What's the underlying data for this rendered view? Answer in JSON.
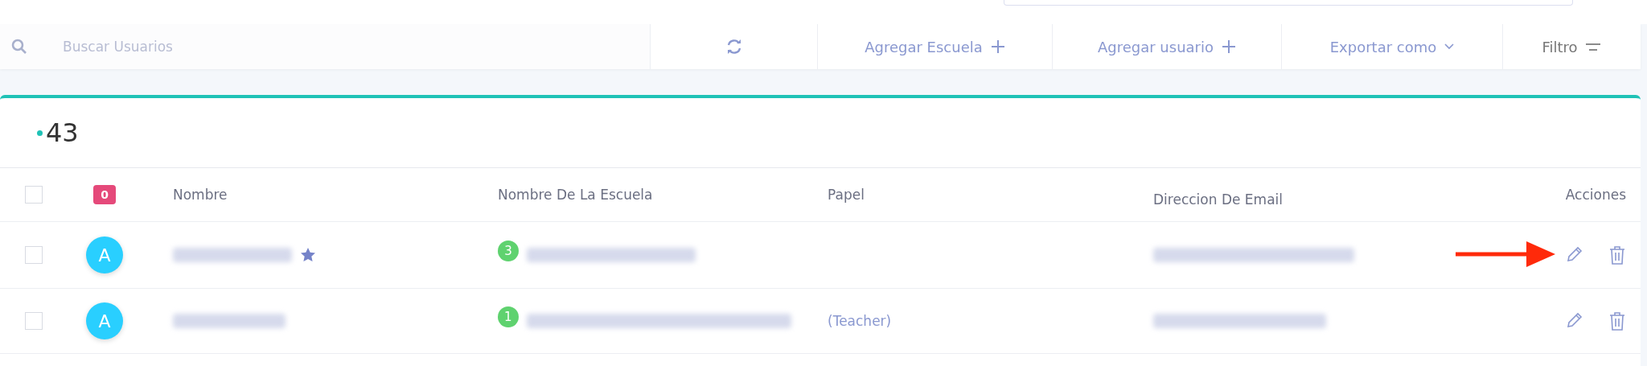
{
  "toolbar": {
    "search": {
      "placeholder": "Buscar Usuarios"
    },
    "actions": [
      {
        "kind": "refresh"
      },
      {
        "kind": "add",
        "label": "Agregar Escuela"
      },
      {
        "kind": "add",
        "label": "Agregar usuario"
      },
      {
        "kind": "dropdown",
        "label": "Exportar como"
      },
      {
        "kind": "filter",
        "label": "Filtro"
      }
    ]
  },
  "card": {
    "count": "43",
    "table": {
      "all_checked": false,
      "selected_badge": "0",
      "columns": [
        "Nombre",
        "Nombre De La Escuela",
        "Papel",
        "Direccion De Email",
        "Acciones"
      ],
      "rows": [
        {
          "checked": false,
          "avatar": "A",
          "name_redacted": true,
          "starred": true,
          "school_count": "3",
          "school_redacted": true,
          "role": null,
          "email_redacted": true,
          "annotated": true
        },
        {
          "checked": false,
          "avatar": "A",
          "name_redacted": true,
          "starred": false,
          "school_count": "1",
          "school_redacted": true,
          "role": "(Teacher)",
          "email_redacted": true,
          "annotated": false
        }
      ]
    }
  }
}
